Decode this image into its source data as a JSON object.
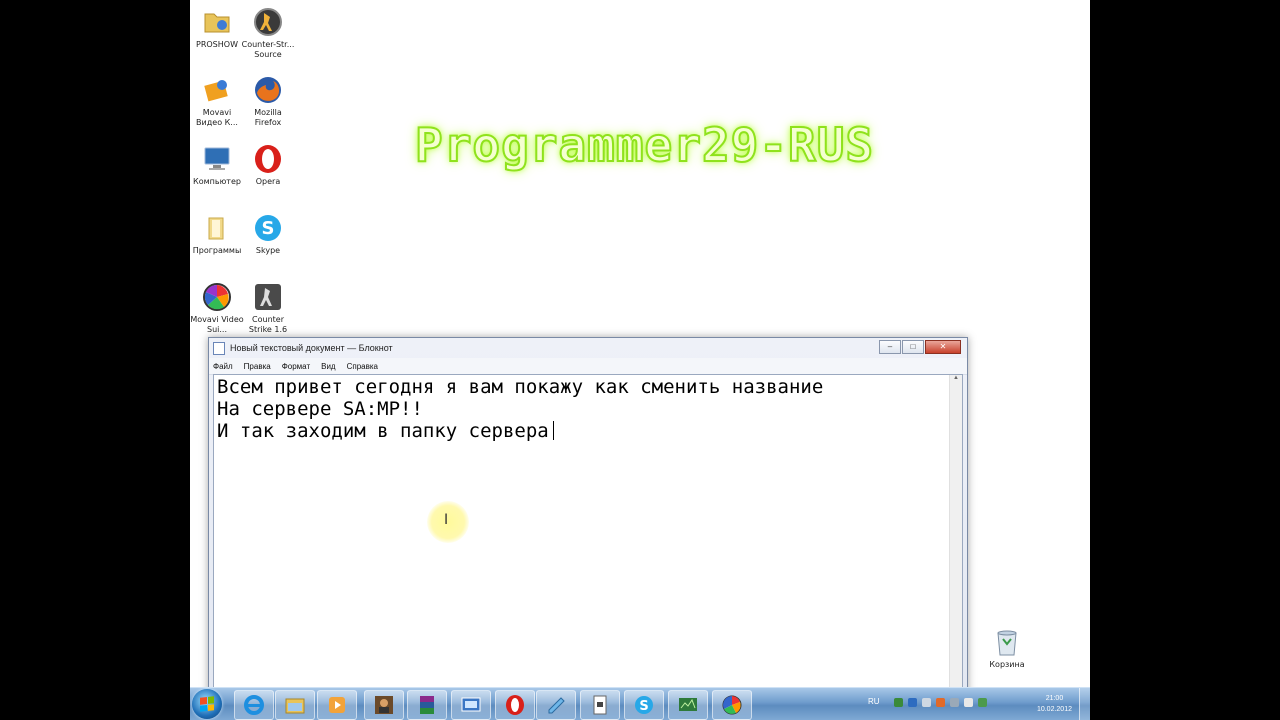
{
  "desktop": {
    "icons": [
      {
        "label": "PROSHOW",
        "icon": "folder-icon"
      },
      {
        "label": "Counter-Str... Source",
        "icon": "counter-strike-icon"
      },
      {
        "label": "Movavi Видео К...",
        "icon": "movavi-icon"
      },
      {
        "label": "Mozilla Firefox",
        "icon": "firefox-icon"
      },
      {
        "label": "Компьютер",
        "icon": "computer-icon"
      },
      {
        "label": "Opera",
        "icon": "opera-icon"
      },
      {
        "label": "Программы",
        "icon": "folder-icon"
      },
      {
        "label": "Skype",
        "icon": "skype-icon"
      },
      {
        "label": "Movavi Video Sui...",
        "icon": "movavi-suite-icon"
      },
      {
        "label": "Counter Strike 1.6",
        "icon": "counter-strike-icon"
      },
      {
        "label": "Корзина",
        "icon": "recycle-bin-icon"
      }
    ],
    "watermark": "Programmer29-RUS"
  },
  "notepad": {
    "title": "Новый текстовый документ — Блокнот",
    "menu": [
      "Файл",
      "Правка",
      "Формат",
      "Вид",
      "Справка"
    ],
    "lines": [
      "Всем привет сегодня я вам покажу как сменить название",
      "На сервере SA:MP!!",
      "И так заходим в папку сервера"
    ],
    "window_buttons": {
      "minimize": "–",
      "maximize": "□",
      "close": "✕"
    }
  },
  "taskbar": {
    "language": "RU",
    "time": "21:00",
    "date": "10.02.2012",
    "buttons": [
      "internet-explorer-icon",
      "explorer-icon",
      "media-player-icon",
      "gta-icon",
      "winrar-icon",
      "screen-recorder-icon",
      "opera-icon",
      "notepad-icon",
      "document-icon",
      "skype-icon",
      "monitor-app-icon",
      "movavi-icon"
    ]
  },
  "colors": {
    "watermark_stroke": "#8fe21c",
    "taskbar": "#6f9ccc",
    "opera_red": "#d9201a",
    "skype_blue": "#27a8e8"
  }
}
